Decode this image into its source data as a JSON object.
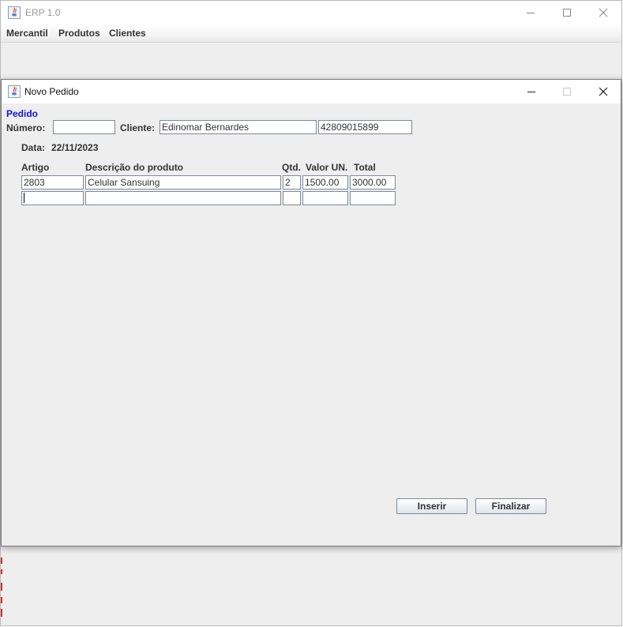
{
  "main_window": {
    "title": "ERP 1.0",
    "menu": [
      "Mercantil",
      "Produtos",
      "Clientes"
    ]
  },
  "dialog": {
    "title": "Novo Pedido",
    "section_title": "Pedido",
    "numero_label": "Número:",
    "numero_value": "",
    "cliente_label": "Cliente:",
    "cliente_name": "Edinomar Bernardes",
    "cliente_doc": "42809015899",
    "data_label": "Data:",
    "data_value": "22/11/2023",
    "columns": [
      "Artigo",
      "Descrição do produto",
      "Qtd.",
      "Valor UN.",
      "Total"
    ],
    "rows": [
      [
        "2803",
        "Celular Sansuing",
        "2",
        "1500.00",
        "3000.00"
      ],
      [
        "",
        "",
        "",
        "",
        ""
      ]
    ],
    "inserir_label": "Inserir",
    "finalizar_label": "Finalizar"
  },
  "icons": {
    "app": "java-app-icon",
    "minimize": "minimize-icon",
    "maximize": "maximize-icon",
    "close": "close-icon"
  }
}
